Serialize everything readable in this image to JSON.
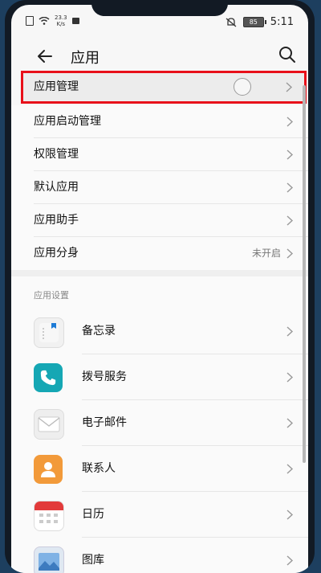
{
  "status": {
    "speed_top": "23.3",
    "speed_unit": "K/s",
    "battery": "85",
    "time": "5:11"
  },
  "header": {
    "title": "应用",
    "back_icon": "back-arrow-icon",
    "search_icon": "search-icon"
  },
  "menu": {
    "items": [
      {
        "label": "应用管理",
        "value": ""
      },
      {
        "label": "应用启动管理",
        "value": ""
      },
      {
        "label": "权限管理",
        "value": ""
      },
      {
        "label": "默认应用",
        "value": ""
      },
      {
        "label": "应用助手",
        "value": ""
      },
      {
        "label": "应用分身",
        "value": "未开启"
      }
    ]
  },
  "app_settings": {
    "header": "应用设置",
    "items": [
      {
        "label": "备忘录",
        "icon": "notepad-icon"
      },
      {
        "label": "拨号服务",
        "icon": "phone-icon"
      },
      {
        "label": "电子邮件",
        "icon": "email-icon"
      },
      {
        "label": "联系人",
        "icon": "contacts-icon"
      },
      {
        "label": "日历",
        "icon": "calendar-icon"
      },
      {
        "label": "图库",
        "icon": "gallery-icon"
      }
    ]
  },
  "colors": {
    "highlight_border": "#e8101a",
    "phone_teal": "#15a7b4",
    "contacts_orange": "#f29a3a",
    "calendar_red": "#e23a3a"
  }
}
